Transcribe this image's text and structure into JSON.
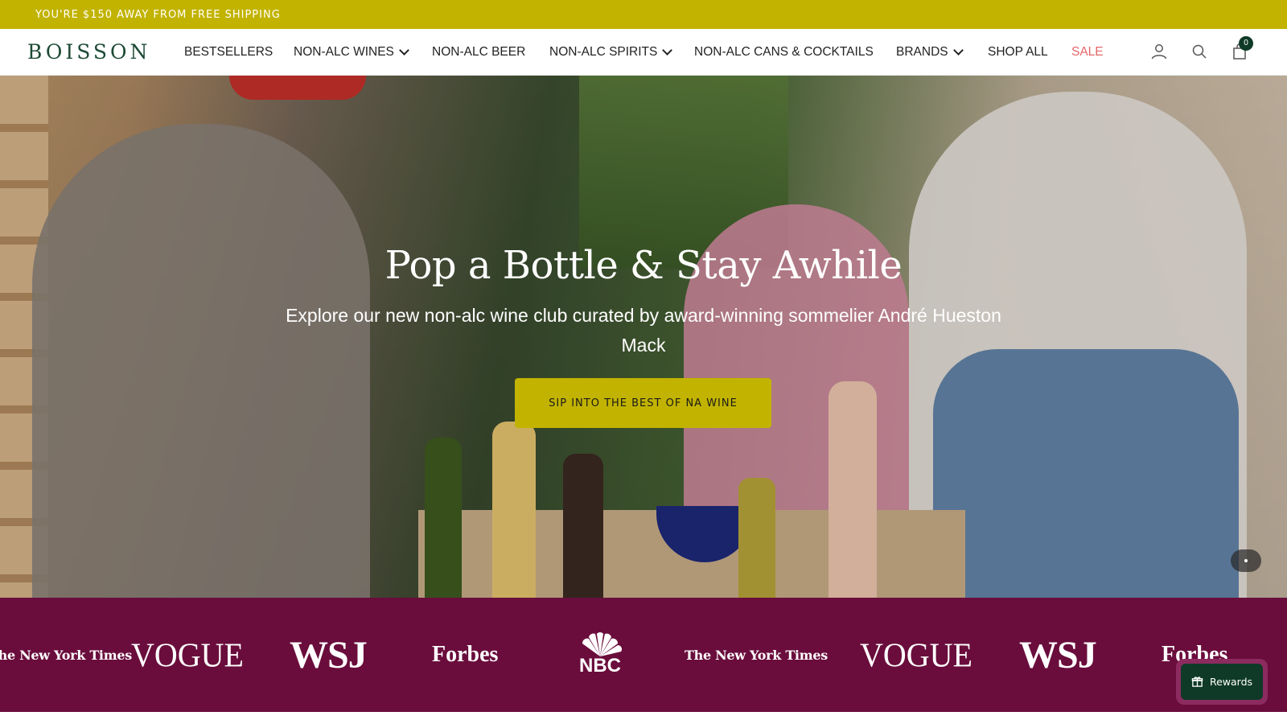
{
  "announcement": {
    "text": "YOU'RE $150 AWAY FROM FREE SHIPPING"
  },
  "header": {
    "logo": "BOISSON",
    "nav": [
      {
        "label": "BESTSELLERS",
        "dropdown": false
      },
      {
        "label": "NON-ALC WINES",
        "dropdown": true
      },
      {
        "label": "NON-ALC BEER",
        "dropdown": false
      },
      {
        "label": "NON-ALC SPIRITS",
        "dropdown": true
      },
      {
        "label": "NON-ALC CANS & COCKTAILS",
        "dropdown": false
      },
      {
        "label": "BRANDS",
        "dropdown": true
      },
      {
        "label": "SHOP ALL",
        "dropdown": false
      },
      {
        "label": "SALE",
        "dropdown": false
      }
    ],
    "icons": [
      "account-icon",
      "search-icon",
      "cart-icon"
    ],
    "cart_count": "0"
  },
  "hero": {
    "title": "Pop a Bottle & Stay Awhile",
    "subtitle": "Explore our new non-alc wine club curated by award-winning sommelier André Hueston Mack",
    "cta": "SIP INTO THE BEST OF NA WINE"
  },
  "press": {
    "logos": [
      "The New York Times",
      "VOGUE",
      "WSJ",
      "Forbes",
      "NBC",
      "The New York Times",
      "VOGUE",
      "WSJ",
      "Forbes"
    ]
  },
  "rewards": {
    "label": "Rewards"
  },
  "colors": {
    "announcement_bg": "#c2b300",
    "brand_green": "#1d4a35",
    "sale": "#e7666a",
    "press_bg": "#6a0d3c",
    "rewards_bg": "#0f3a27"
  }
}
